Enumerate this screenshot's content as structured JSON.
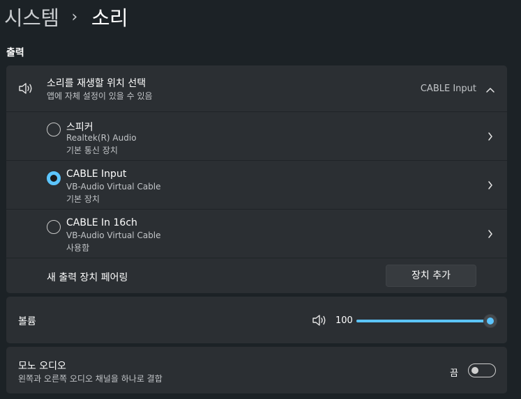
{
  "breadcrumb": {
    "parent": "시스템",
    "separator": "›",
    "current": "소리"
  },
  "output": {
    "section_title": "출력",
    "selector": {
      "title": "소리를 재생할 위치 선택",
      "subtitle": "앱에 자체 설정이 있을 수 있음",
      "current_value": "CABLE Input",
      "icon": "speaker-icon",
      "expanded": true
    },
    "devices": [
      {
        "name": "스피커",
        "line1": "Realtek(R) Audio",
        "line2": "기본 통신 장치",
        "selected": false
      },
      {
        "name": "CABLE Input",
        "line1": "VB-Audio Virtual Cable",
        "line2": "기본 장치",
        "selected": true
      },
      {
        "name": "CABLE In 16ch",
        "line1": "VB-Audio Virtual Cable",
        "line2": "사용함",
        "selected": false
      }
    ],
    "pair": {
      "label": "새 출력 장치 페어링",
      "button_label": "장치 추가"
    }
  },
  "volume": {
    "label": "볼륨",
    "value_text": "100",
    "level": 1.0,
    "icon": "speaker-icon"
  },
  "mono": {
    "title": "모노 오디오",
    "subtitle": "왼쪽과 오른쪽 오디오 채널을 하나로 결합",
    "toggle_state": "끔",
    "on": false
  },
  "colors": {
    "accent": "#5cc5ff",
    "background": "#1c2226",
    "card": "#2b2f33"
  }
}
